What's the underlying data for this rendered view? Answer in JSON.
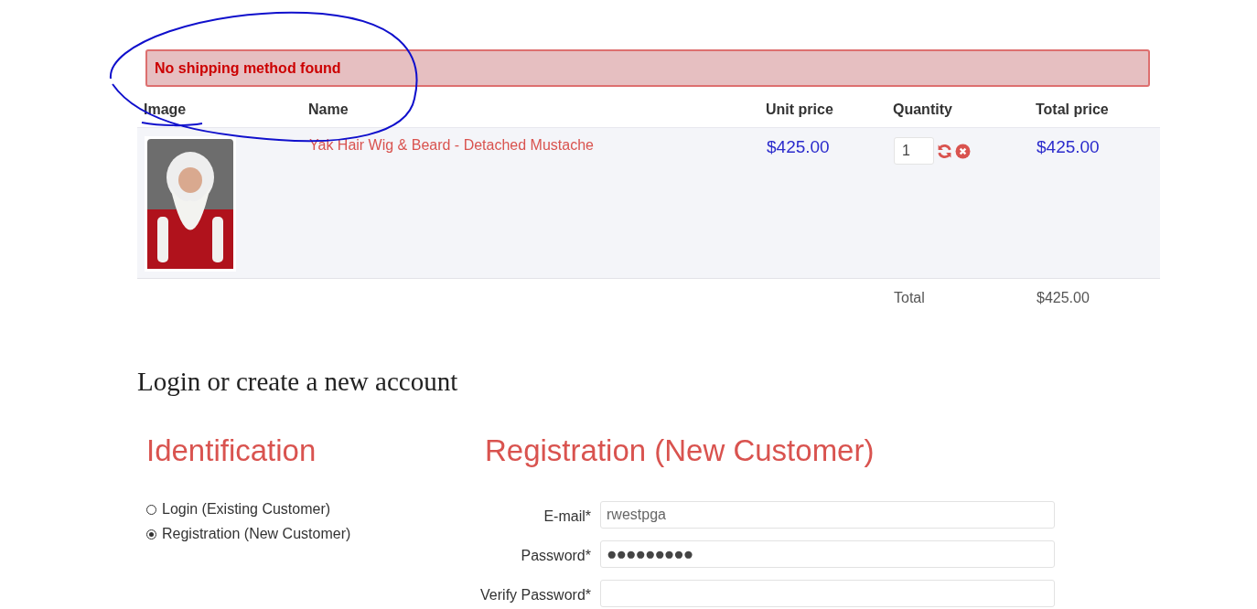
{
  "alert": {
    "message": "No shipping method found"
  },
  "cart": {
    "columns": [
      "Image",
      "Name",
      "Unit price",
      "Quantity",
      "Total price"
    ],
    "rows": [
      {
        "name": "Yak Hair Wig & Beard - Detached Mustache",
        "unit_price": "$425.00",
        "quantity": "1",
        "total_price": "$425.00"
      }
    ],
    "total_label": "Total",
    "total_value": "$425.00"
  },
  "login": {
    "title": "Login or create a new account",
    "identification": {
      "title": "Identification",
      "options": [
        {
          "label": "Login (Existing Customer)",
          "selected": false
        },
        {
          "label": "Registration (New Customer)",
          "selected": true
        }
      ]
    },
    "registration": {
      "title": "Registration (New Customer)",
      "fields": [
        {
          "label": "E-mail*",
          "value": "rwestpga",
          "kind": "text"
        },
        {
          "label": "Password*",
          "value": "●●●●●●●●●",
          "kind": "password"
        },
        {
          "label": "Verify Password*",
          "kind": "password"
        }
      ]
    }
  }
}
